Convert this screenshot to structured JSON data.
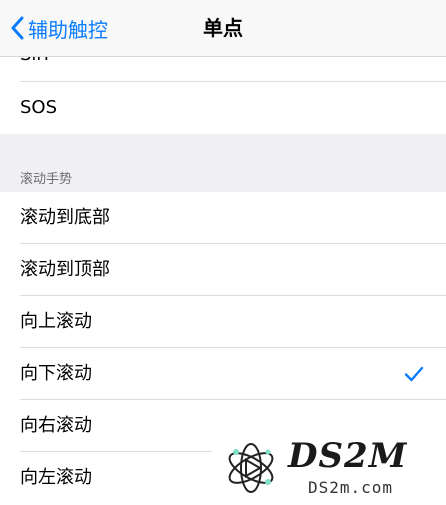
{
  "navbar": {
    "back_label": "辅助触控",
    "title": "单点"
  },
  "top_group": {
    "partial_item": "Siri",
    "items": [
      {
        "label": "SOS"
      }
    ]
  },
  "scroll_section": {
    "header": "滚动手势",
    "items": [
      {
        "label": "滚动到底部",
        "selected": false
      },
      {
        "label": "滚动到顶部",
        "selected": false
      },
      {
        "label": "向上滚动",
        "selected": false
      },
      {
        "label": "向下滚动",
        "selected": true
      },
      {
        "label": "向右滚动",
        "selected": false
      },
      {
        "label": "向左滚动",
        "selected": false
      }
    ]
  },
  "colors": {
    "accent": "#0a7cff",
    "background": "#efeff4",
    "separator": "#dcdce0"
  },
  "icons": {
    "back": "chevron-left-icon",
    "selected": "checkmark-icon"
  },
  "watermark": {
    "brand": "DS2M",
    "domain": "DS2m.com"
  }
}
